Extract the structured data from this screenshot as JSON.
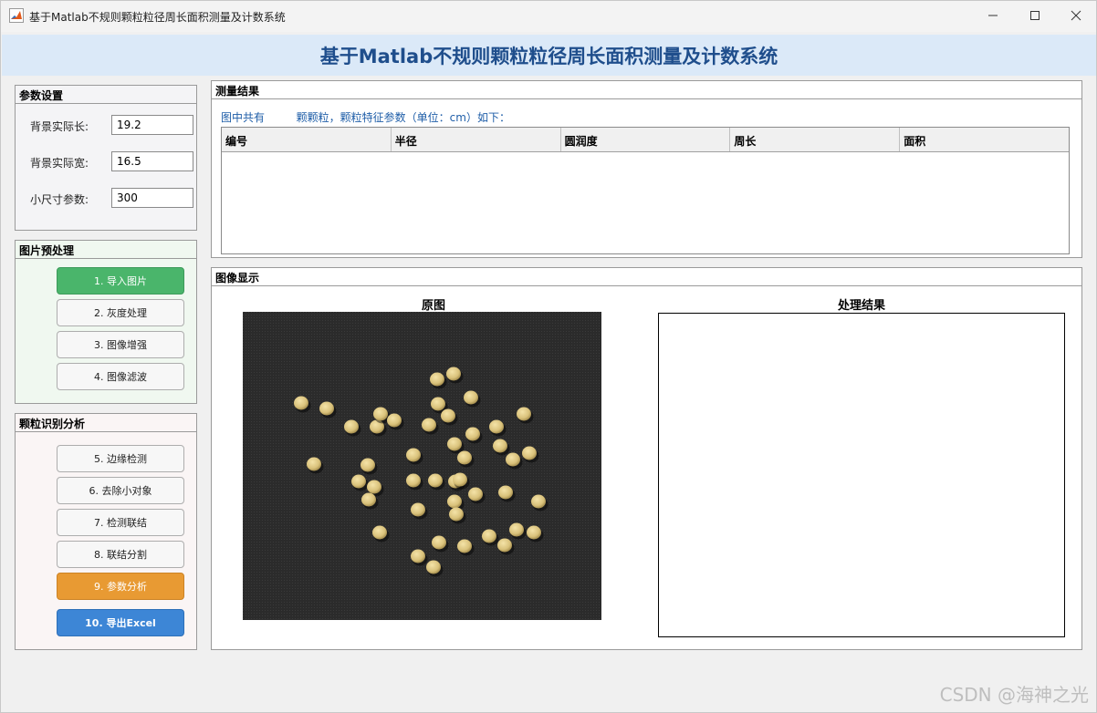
{
  "window": {
    "title": "基于Matlab不规则颗粒粒径周长面积测量及计数系统",
    "controls": [
      "minimize",
      "maximize",
      "close"
    ]
  },
  "banner": {
    "title": "基于Matlab不规则颗粒粒径周长面积测量及计数系统"
  },
  "params": {
    "title": "参数设置",
    "fields": [
      {
        "label": "背景实际长:",
        "value": "19.2"
      },
      {
        "label": "背景实际宽:",
        "value": "16.5"
      },
      {
        "label": "小尺寸参数:",
        "value": "300"
      }
    ]
  },
  "preprocess": {
    "title": "图片预处理",
    "buttons": [
      "1. 导入图片",
      "2. 灰度处理",
      "3. 图像增强",
      "4. 图像滤波"
    ]
  },
  "analysis": {
    "title": "颗粒识别分析",
    "buttons": [
      "5. 边缘检测",
      "6. 去除小对象",
      "7. 检测联结",
      "8. 联结分割",
      "9. 参数分析",
      "10. 导出Excel"
    ]
  },
  "results": {
    "title": "测量结果",
    "summary_prefix": "图中共有",
    "summary_count": "",
    "summary_suffix": "颗颗粒，颗粒特征参数（单位：cm）如下：",
    "columns": [
      "编号",
      "半径",
      "圆润度",
      "周长",
      "面积"
    ],
    "rows": []
  },
  "display": {
    "title": "图像显示",
    "original_title": "原图",
    "result_title": "处理结果"
  },
  "colors": {
    "banner_bg": "#dbe9f8",
    "banner_text": "#1f4e8c",
    "green_button": "#4ab56b",
    "orange_button": "#e89a33",
    "blue_button": "#3d86d6",
    "summary_text": "#1f5ea8"
  },
  "icons": {
    "app": "matlab-icon",
    "min": "minimize-icon",
    "max": "maximize-icon",
    "close": "close-icon"
  },
  "watermark": "CSDN @海神之光"
}
